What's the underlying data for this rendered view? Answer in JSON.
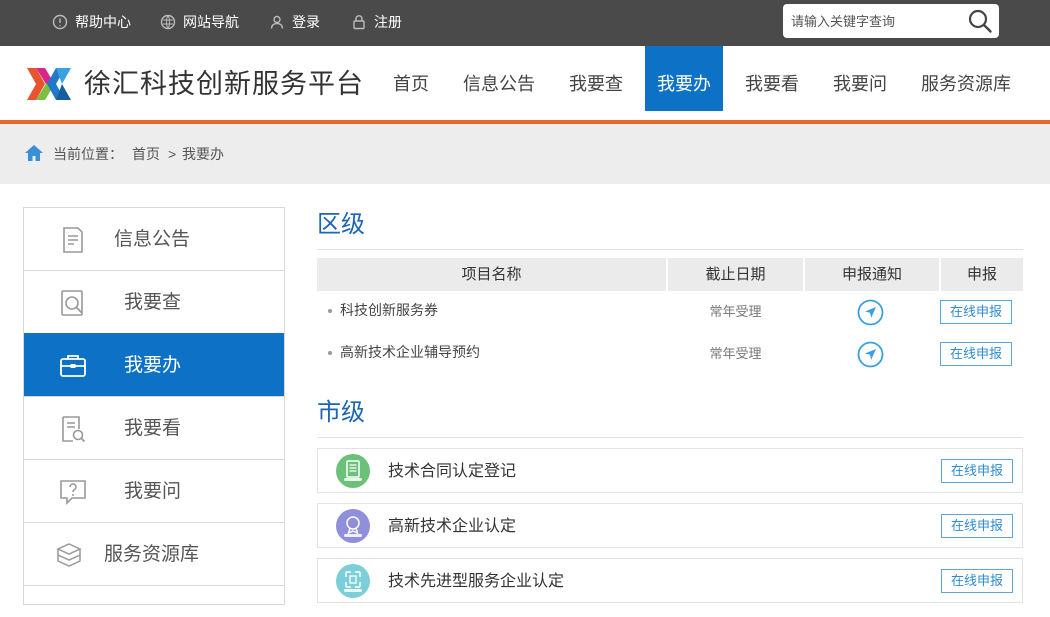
{
  "topbar": {
    "links": [
      {
        "label": "帮助中心"
      },
      {
        "label": "网站导航"
      },
      {
        "label": "登录"
      },
      {
        "label": "注册"
      }
    ],
    "search_placeholder": "请输入关键字查询"
  },
  "header": {
    "site_title": "徐汇科技创新服务平台",
    "nav": [
      {
        "label": "首页"
      },
      {
        "label": "信息公告"
      },
      {
        "label": "我要查"
      },
      {
        "label": "我要办",
        "active": true
      },
      {
        "label": "我要看"
      },
      {
        "label": "我要问"
      },
      {
        "label": "服务资源库"
      }
    ]
  },
  "breadcrumb": {
    "prefix": "当前位置：",
    "home": "首页",
    "separator": ">",
    "current": "我要办"
  },
  "sidebar": {
    "items": [
      {
        "label": "信息公告",
        "icon": "document-icon"
      },
      {
        "label": "我要查",
        "icon": "search-doc-icon"
      },
      {
        "label": "我要办",
        "icon": "briefcase-icon",
        "active": true
      },
      {
        "label": "我要看",
        "icon": "view-doc-icon"
      },
      {
        "label": "我要问",
        "icon": "question-icon"
      },
      {
        "label": "服务资源库",
        "icon": "boxes-icon"
      }
    ]
  },
  "district": {
    "title": "区级",
    "columns": [
      "项目名称",
      "截止日期",
      "申报通知",
      "申报"
    ],
    "rows": [
      {
        "name": "科技创新服务券",
        "date": "常年受理",
        "apply": "在线申报"
      },
      {
        "name": "高新技术企业辅导预约",
        "date": "常年受理",
        "apply": "在线申报"
      }
    ]
  },
  "city": {
    "title": "市级",
    "items": [
      {
        "name": "技术合同认定登记",
        "apply": "在线申报",
        "icon_color": "#6cc17a"
      },
      {
        "name": "高新技术企业认定",
        "apply": "在线申报",
        "icon_color": "#8f8fdc"
      },
      {
        "name": "技术先进型服务企业认定",
        "apply": "在线申报",
        "icon_color": "#7ccfd8"
      }
    ]
  },
  "colors": {
    "topbar": "#4a4a4a",
    "primary": "#0d72c6",
    "accent": "#e8672f",
    "section_title": "#1d66b4"
  }
}
